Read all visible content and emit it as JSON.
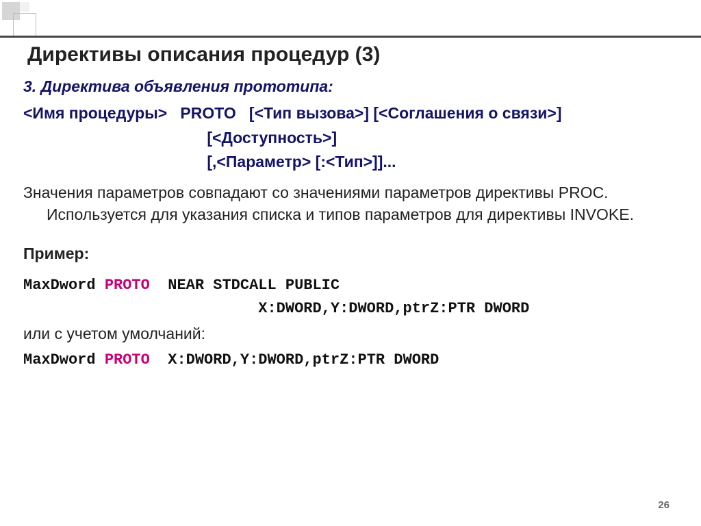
{
  "title": "Директивы описания процедур (3)",
  "subhead": "3. Директива объявления прототипа:",
  "syntax_l1": "<Имя процедуры>   PROTO   [<Тип вызова>] [<Соглашения о связи>]",
  "syntax_l2": "                                          [<Доступность>]",
  "syntax_l3": "                                          [,<Параметр> [:<Тип>]]...",
  "body": "Значения параметров совпадают со значениями параметров директивы PROC. Используется для указания списка и типов параметров для директивы INVOKE.",
  "example_label": "Пример:",
  "code1_a": "MaxDword ",
  "code1_kw": "PROTO",
  "code1_b": "  NEAR STDCALL PUBLIC",
  "code1_l2": "                          X:DWORD,Y:DWORD,ptrZ:PTR DWORD",
  "between": "или с учетом умолчаний:",
  "code2_a": "MaxDword ",
  "code2_kw": "PROTO",
  "code2_b": "  X:DWORD,Y:DWORD,ptrZ:PTR DWORD",
  "page_number": "26"
}
